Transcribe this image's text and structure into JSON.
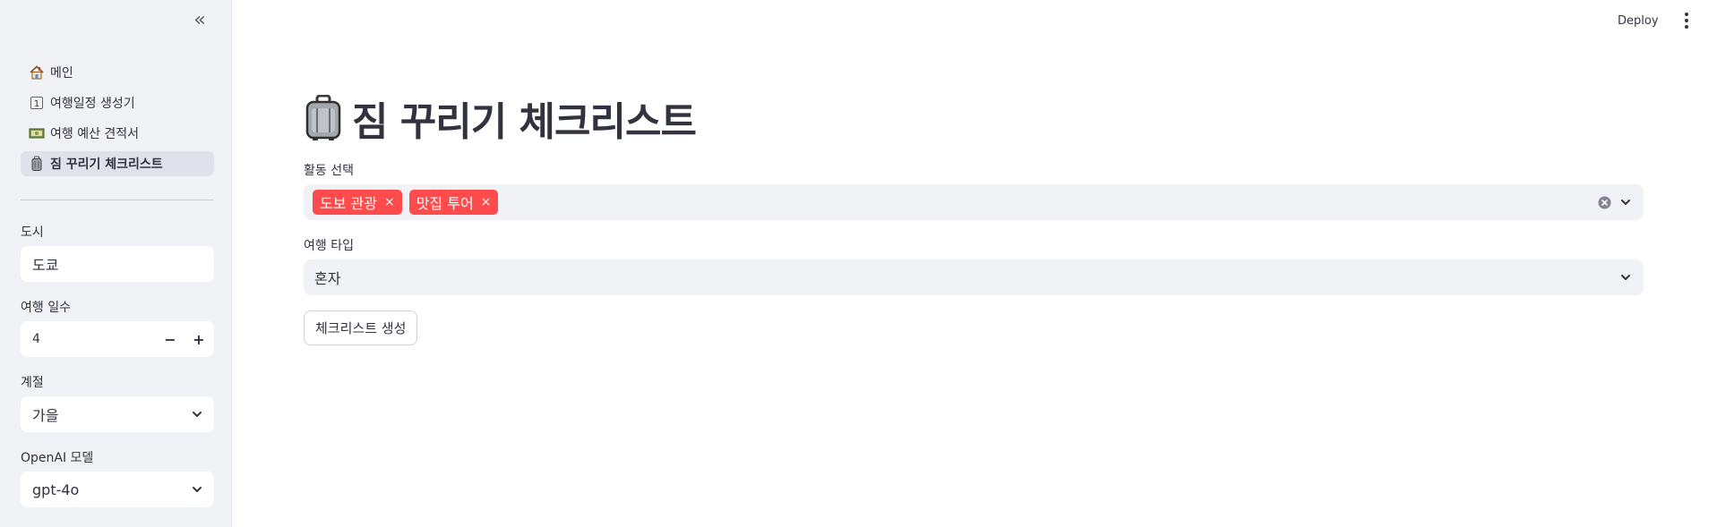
{
  "header": {
    "deploy_label": "Deploy"
  },
  "sidebar": {
    "collapse_glyph": "«",
    "nav": [
      {
        "label": "메인",
        "icon": "house-icon"
      },
      {
        "label": "여행일정 생성기",
        "icon": "calendar-one-icon"
      },
      {
        "label": "여행 예산 견적서",
        "icon": "banknote-icon"
      },
      {
        "label": "짐 꾸리기 체크리스트",
        "icon": "luggage-icon",
        "active": true
      }
    ],
    "city": {
      "label": "도시",
      "value": "도쿄"
    },
    "days": {
      "label": "여행 일수",
      "value": "4",
      "minus": "−",
      "plus": "+"
    },
    "season": {
      "label": "계절",
      "value": "가을"
    },
    "model": {
      "label": "OpenAI 모델",
      "value": "gpt-4o"
    }
  },
  "main": {
    "title": "짐 꾸리기 체크리스트",
    "activities": {
      "label": "활동 선택",
      "tags": [
        "도보 관광",
        "맛집 투어"
      ],
      "remove_glyph": "×"
    },
    "travel_type": {
      "label": "여행 타입",
      "value": "혼자"
    },
    "generate_label": "체크리스트 생성"
  },
  "colors": {
    "accent": "#ff4b4b",
    "sidebar_bg": "#f0f2f6",
    "text": "#31333f"
  }
}
